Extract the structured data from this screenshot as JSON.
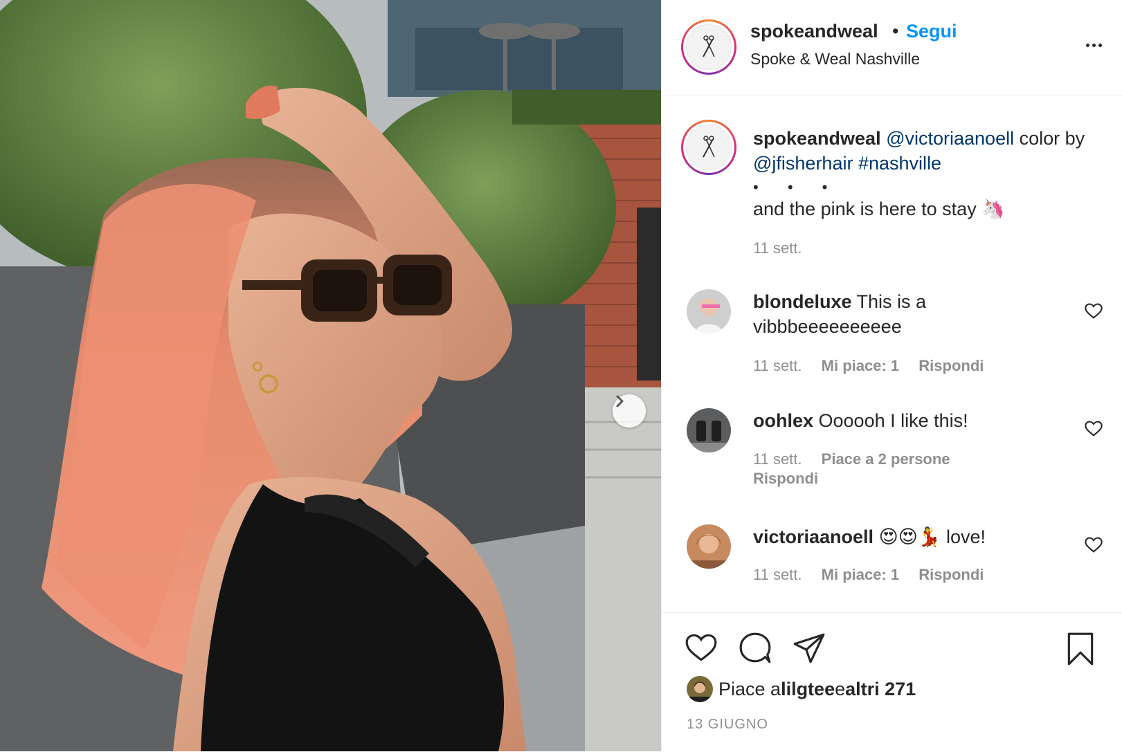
{
  "post": {
    "username": "spokeandweal",
    "separator": "•",
    "follow_label": "Segui",
    "location": "Spoke & Weal Nashville",
    "more_icon": "more-options-icon"
  },
  "caption": {
    "username": "spokeandweal",
    "mention1": "@victoriaanoell",
    "text1": " color by ",
    "mention2": "@jfisherhair",
    "space": " ",
    "hashtag": "#nashville",
    "dots": "• • •",
    "body": "and the pink is here to stay 🦄",
    "time": "11 sett."
  },
  "comments": [
    {
      "username": "blondeluxe",
      "text": " This is a vibbbeeeeeeeeee",
      "time": "11 sett.",
      "likes": "Mi piace: 1",
      "reply": "Rispondi"
    },
    {
      "username": "oohlex",
      "text": " Oooooh I like this!",
      "time": "11 sett.",
      "likes": "Piace a 2 persone",
      "reply": "Rispondi"
    },
    {
      "username": "victoriaanoell",
      "text": " 😍😍💃 love!",
      "time": "11 sett.",
      "likes": "Mi piace: 1",
      "reply": "Rispondi"
    }
  ],
  "likes_summary": {
    "prefix": "Piace a ",
    "user": "lilgtee",
    "middle": " e ",
    "others": "altri 271"
  },
  "date": "13 GIUGNO",
  "colors": {
    "link_blue": "#0095f6",
    "mention_blue": "#00376b",
    "text": "#262626",
    "muted": "#8e8e8e"
  }
}
